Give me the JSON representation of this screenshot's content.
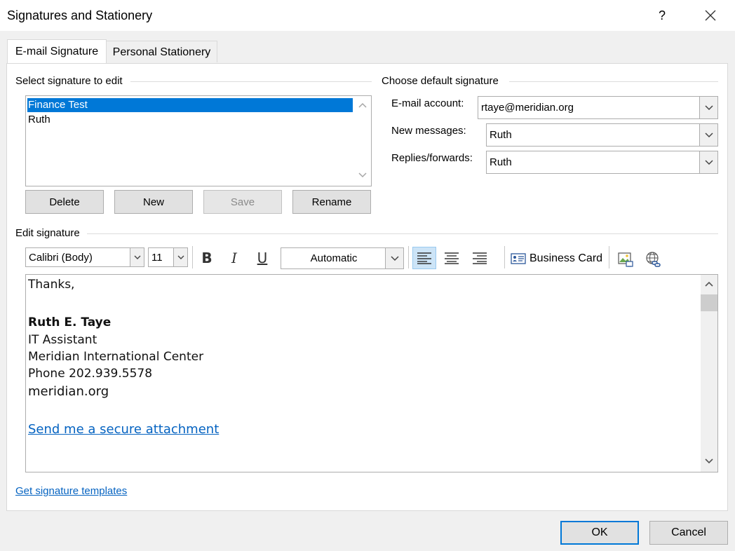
{
  "window": {
    "title": "Signatures and Stationery",
    "help": "?",
    "close_icon": "close-icon"
  },
  "tabs": [
    {
      "label": "E-mail Signature",
      "active": true
    },
    {
      "label": "Personal Stationery",
      "active": false
    }
  ],
  "select_section": {
    "label": "Select signature to edit",
    "items": [
      {
        "label": "Finance Test",
        "selected": true
      },
      {
        "label": "Ruth",
        "selected": false
      }
    ],
    "buttons": {
      "delete": "Delete",
      "new": "New",
      "save": "Save",
      "rename": "Rename"
    }
  },
  "default_section": {
    "label": "Choose default signature",
    "email_account_label": "E-mail account:",
    "email_account_value": "rtaye@meridian.org",
    "new_messages_label": "New messages:",
    "new_messages_value": "Ruth",
    "replies_label": "Replies/forwards:",
    "replies_value": "Ruth"
  },
  "edit_section": {
    "label": "Edit signature",
    "toolbar": {
      "font": "Calibri (Body)",
      "size": "11",
      "bold": "B",
      "italic": "I",
      "underline": "U",
      "color": "Automatic",
      "business_card": "Business Card"
    },
    "content": {
      "line1": "Thanks,",
      "name": "Ruth E. Taye",
      "role": "IT Assistant",
      "org": "Meridian International Center",
      "phone": "Phone 202.939.5578",
      "site": "meridian.org",
      "link": "Send me a secure attachment"
    }
  },
  "footer": {
    "templates_link": "Get signature templates",
    "ok": "OK",
    "cancel": "Cancel"
  },
  "colors": {
    "accent": "#0078d7",
    "link": "#0563c1",
    "active_toolbar": "#cce4f7"
  }
}
